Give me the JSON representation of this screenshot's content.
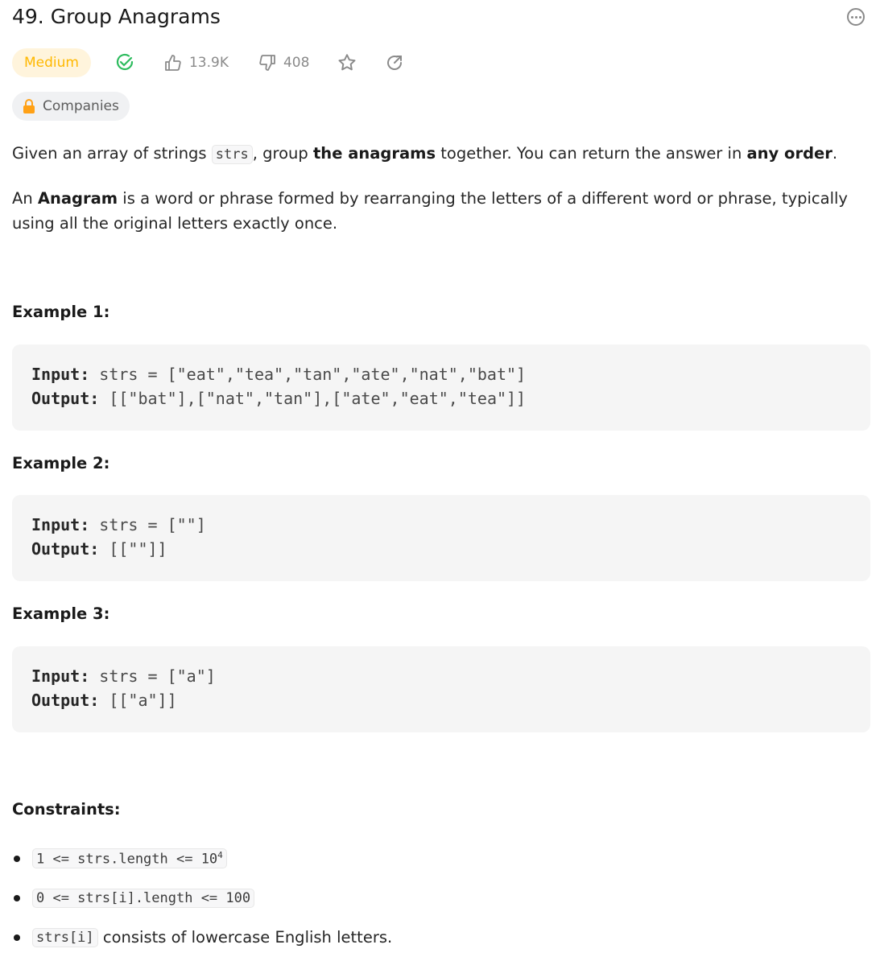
{
  "title": "49. Group Anagrams",
  "difficulty": "Medium",
  "likes": "13.9K",
  "dislikes": "408",
  "companies": "Companies",
  "desc": {
    "p1a": "Given an array of strings ",
    "p1code": "strs",
    "p1b": ", group ",
    "p1bold": "the anagrams",
    "p1c": " together. You can return the answer in ",
    "p1bold2": "any order",
    "p1d": ".",
    "p2a": "An ",
    "p2bold": "Anagram",
    "p2b": " is a word or phrase formed by rearranging the letters of a different word or phrase, typically using all the original letters exactly once."
  },
  "examples": [
    {
      "heading": "Example 1:",
      "input_label": "Input:",
      "input": " strs = [\"eat\",\"tea\",\"tan\",\"ate\",\"nat\",\"bat\"]",
      "output_label": "Output:",
      "output": " [[\"bat\"],[\"nat\",\"tan\"],[\"ate\",\"eat\",\"tea\"]]"
    },
    {
      "heading": "Example 2:",
      "input_label": "Input:",
      "input": " strs = [\"\"]",
      "output_label": "Output:",
      "output": " [[\"\"]]"
    },
    {
      "heading": "Example 3:",
      "input_label": "Input:",
      "input": " strs = [\"a\"]",
      "output_label": "Output:",
      "output": " [[\"a\"]]"
    }
  ],
  "constraints": {
    "heading": "Constraints:",
    "c1": "1 <= strs.length <= 10",
    "c1sup": "4",
    "c2": "0 <= strs[i].length <= 100",
    "c3code": "strs[i]",
    "c3text": " consists of lowercase English letters."
  }
}
